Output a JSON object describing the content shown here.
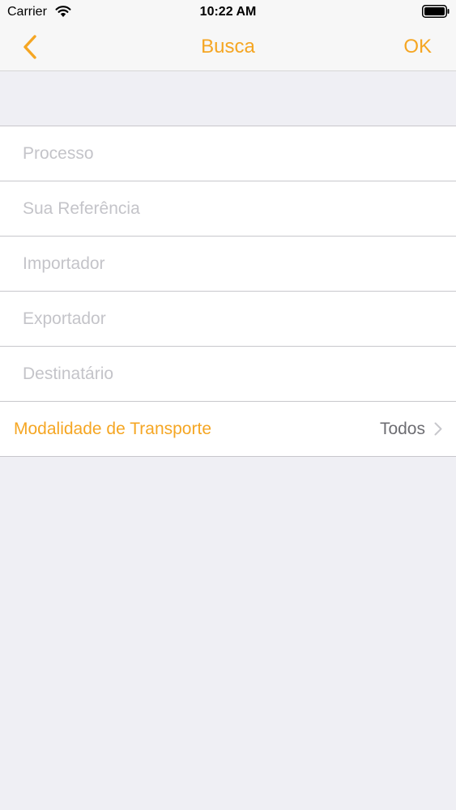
{
  "status_bar": {
    "carrier": "Carrier",
    "time": "10:22 AM",
    "icons": [
      "wifi-icon",
      "battery-icon"
    ]
  },
  "nav": {
    "title": "Busca",
    "ok_label": "OK",
    "back_icon": "chevron-left-icon",
    "accent_color": "#f5a623"
  },
  "form": {
    "fields": [
      {
        "placeholder": "Processo",
        "value": ""
      },
      {
        "placeholder": "Sua Referência",
        "value": ""
      },
      {
        "placeholder": "Importador",
        "value": ""
      },
      {
        "placeholder": "Exportador",
        "value": ""
      },
      {
        "placeholder": "Destinatário",
        "value": ""
      }
    ],
    "transport": {
      "label": "Modalidade de Transporte",
      "value": "Todos",
      "icon": "chevron-right-icon"
    }
  }
}
